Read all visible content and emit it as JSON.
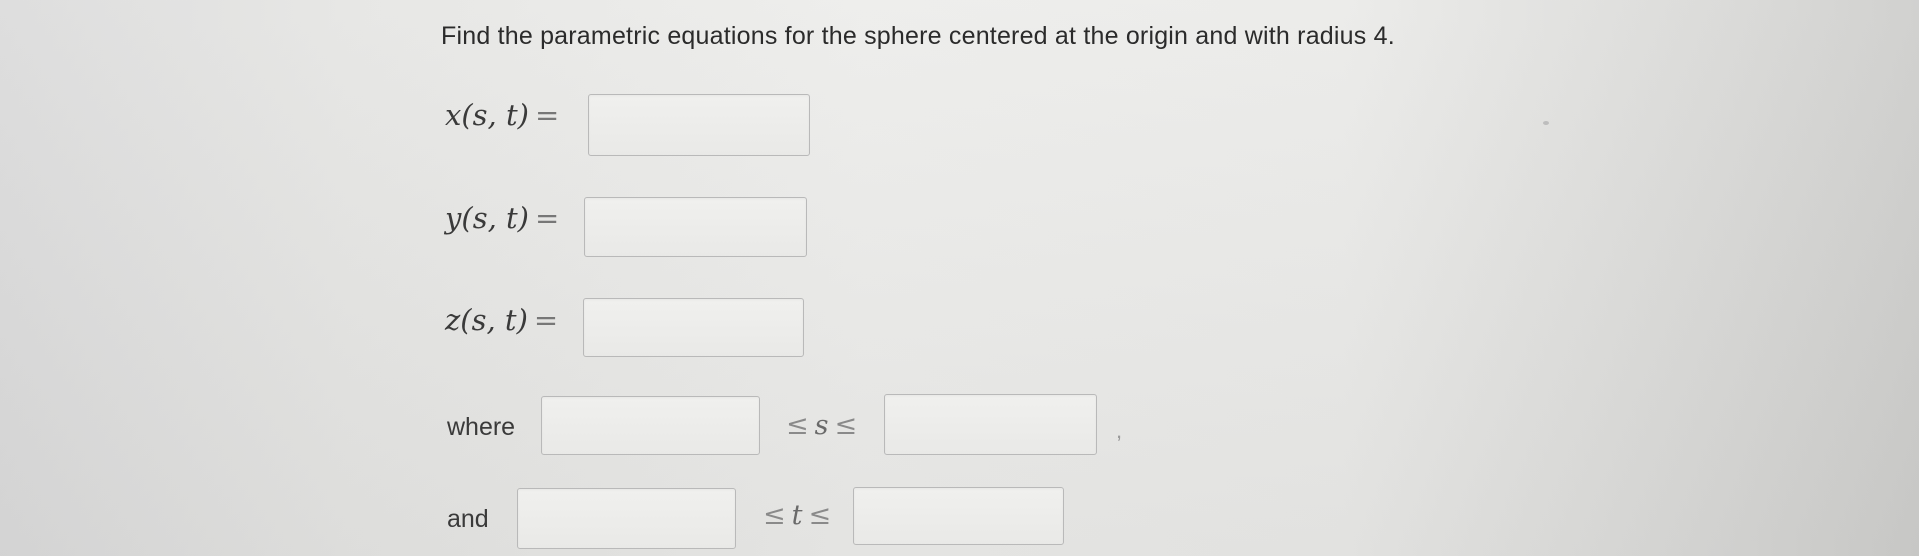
{
  "problem": {
    "text": "Find the parametric equations for the sphere centered at the origin and with radius 4."
  },
  "equations": [
    {
      "label": "x(s, t)",
      "equals": "=",
      "value": ""
    },
    {
      "label": "y(s, t)",
      "equals": "=",
      "value": ""
    },
    {
      "label": "z(s, t)",
      "equals": "=",
      "value": ""
    }
  ],
  "domain_s": {
    "word": "where",
    "relation": "≤",
    "variable": "s",
    "lower_value": "",
    "upper_value": "",
    "comma": ","
  },
  "domain_t": {
    "word": "and",
    "relation": "≤",
    "variable": "t",
    "lower_value": "",
    "upper_value": ""
  }
}
